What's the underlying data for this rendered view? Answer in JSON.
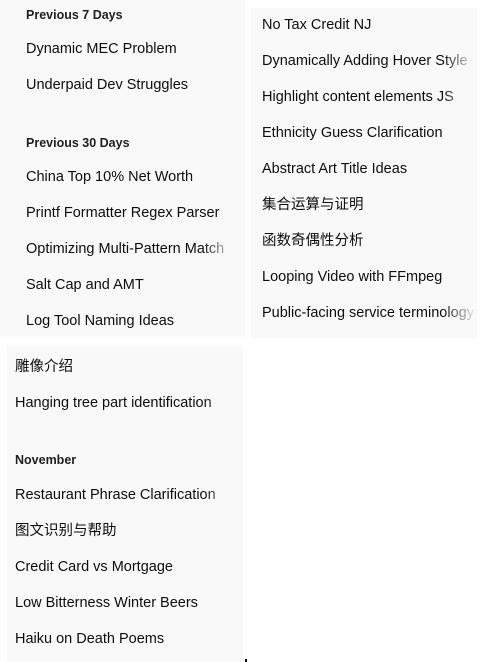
{
  "panel_a": {
    "sections": [
      {
        "heading": "Previous 7 Days",
        "items": [
          "Dynamic MEC Problem",
          "Underpaid Dev Struggles"
        ]
      },
      {
        "heading": "Previous 30 Days",
        "items": [
          "China Top 10% Net Worth",
          "Printf Formatter Regex Parser",
          "Optimizing Multi-Pattern Match",
          "Salt Cap and AMT",
          "Log Tool Naming Ideas"
        ]
      }
    ]
  },
  "panel_b": {
    "items": [
      "No Tax Credit NJ",
      "Dynamically Adding Hover Style",
      "Highlight content elements JS",
      "Ethnicity Guess Clarification",
      "Abstract Art Title Ideas",
      "集合运算与证明",
      "函数奇偶性分析",
      "Looping Video with FFmpeg",
      "Public-facing service terminology"
    ]
  },
  "panel_c": {
    "sections": [
      {
        "heading": "",
        "items": [
          "雕像介绍",
          "Hanging tree part identification"
        ]
      },
      {
        "heading": "November",
        "items": [
          "Restaurant Phrase Clarification",
          "图文识别与帮助",
          "Credit Card vs Mortgage",
          "Low Bitterness Winter Beers",
          "Haiku on Death Poems"
        ]
      }
    ]
  }
}
